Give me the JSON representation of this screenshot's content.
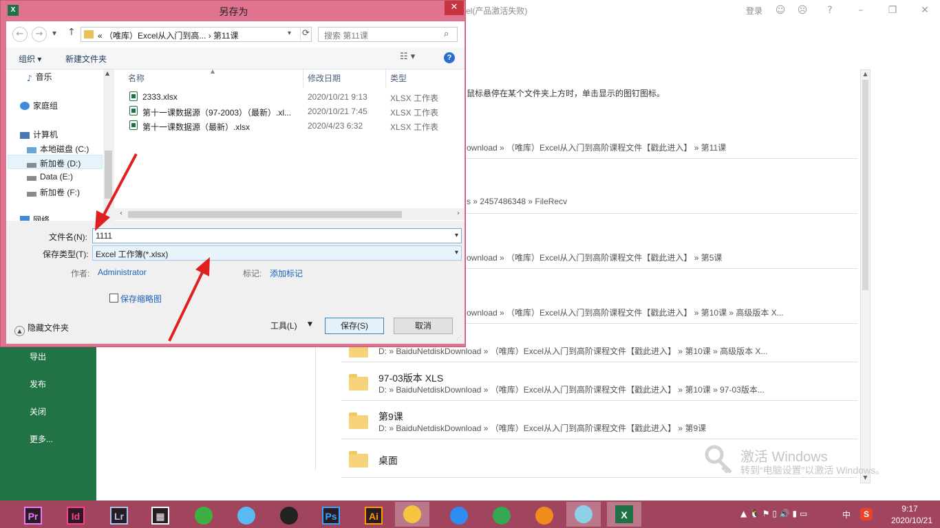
{
  "colors": {
    "dialog_frame": "#e0738f",
    "close_button": "#c7343f",
    "excel_green": "#217346",
    "taskbar": "#a0455d",
    "link": "#1c62b9",
    "annotation_arrow": "#e02020"
  },
  "background": {
    "title": "el(产品激活失败)",
    "login": "登录",
    "hint": "鼠标悬停在某个文件夹上方时，单击显示的图钉图标。",
    "left_nav": [
      "导出",
      "发布",
      "关闭",
      "更多..."
    ],
    "recent": [
      {
        "name": "",
        "path": "ownload » （唯库）Excel从入门到高阶课程文件【戳此进入】 » 第11课"
      },
      {
        "name": "",
        "path": "s » 2457486348 » FileRecv"
      },
      {
        "name": "",
        "path": "ownload » （唯库）Excel从入门到高阶课程文件【戳此进入】 » 第5课"
      },
      {
        "name": "",
        "path": "ownload » （唯库）Excel从入门到高阶课程文件【戳此进入】 » 第10课 » 高级版本 X..."
      },
      {
        "name": "",
        "path": "D: » BaiduNetdiskDownload » （唯库）Excel从入门到高阶课程文件【戳此进入】 » 第10课 » 高级版本 X..."
      },
      {
        "name": "97-03版本 XLS",
        "path": "D: » BaiduNetdiskDownload » （唯库）Excel从入门到高阶课程文件【戳此进入】 » 第10课 » 97-03版本..."
      },
      {
        "name": "第9课",
        "path": "D: » BaiduNetdiskDownload » （唯库）Excel从入门到高阶课程文件【戳此进入】 » 第9课"
      },
      {
        "name": "桌面",
        "path": ""
      }
    ],
    "activation": {
      "line1": "激活 Windows",
      "line2": "转到“电脑设置”以激活 Windows。"
    }
  },
  "dialog": {
    "title": "另存为",
    "app_icon": "X",
    "nav": {
      "back_icon": "←",
      "forward_icon": "→",
      "recent_icon": "▾",
      "up_icon": "↑",
      "address": "«  （唯库）Excel从入门到高...  ›  第11课",
      "dropdown_icon": "▾",
      "refresh_icon": "⟳",
      "search_placeholder": "搜索 第11课",
      "search_icon": "⌕"
    },
    "toolbar": {
      "organize": "组织 ▾",
      "new_folder": "新建文件夹",
      "view_icon": "☷ ▾",
      "help_icon": "?"
    },
    "tree": [
      {
        "label": "音乐",
        "icon": "music-icon"
      },
      {
        "label": "家庭组",
        "icon": "homegroup-icon"
      },
      {
        "label": "计算机",
        "icon": "computer-icon"
      },
      {
        "label": "本地磁盘 (C:)",
        "icon": "drive-icon"
      },
      {
        "label": "新加卷 (D:)",
        "icon": "drive-icon"
      },
      {
        "label": "Data (E:)",
        "icon": "drive-icon"
      },
      {
        "label": "新加卷 (F:)",
        "icon": "drive-icon"
      },
      {
        "label": "网络",
        "icon": "network-icon"
      }
    ],
    "columns": {
      "name": "名称",
      "date": "修改日期",
      "type": "类型"
    },
    "files": [
      {
        "name": "2333.xlsx",
        "date": "2020/10/21 9:13",
        "type": "XLSX 工作表"
      },
      {
        "name": "第十一课数据源（97-2003）（最新）.xl...",
        "date": "2020/10/21 7:45",
        "type": "XLSX 工作表"
      },
      {
        "name": "第十一课数据源（最新）.xlsx",
        "date": "2020/4/23 6:32",
        "type": "XLSX 工作表"
      }
    ],
    "form": {
      "filename_label": "文件名(N):",
      "filename_value": "1111",
      "type_label": "保存类型(T):",
      "type_value": "Excel 工作簿(*.xlsx)",
      "author_label": "作者:",
      "author_value": "Administrator",
      "tags_label": "标记:",
      "tags_value": "添加标记",
      "thumbnail_label": "保存缩略图",
      "thumbnail_checked": false,
      "hide_folders": "隐藏文件夹",
      "tools": "工具(L)",
      "save": "保存(S)",
      "cancel": "取消"
    }
  },
  "taskbar": {
    "apps": [
      {
        "name": "Premiere",
        "label": "Pr",
        "color": "#e77bff"
      },
      {
        "name": "InDesign",
        "label": "Id",
        "color": "#ff3f8c"
      },
      {
        "name": "Lightroom",
        "label": "Lr",
        "color": "#a8c8f0"
      },
      {
        "name": "Video",
        "label": "▦",
        "color": "#ffffff"
      },
      {
        "name": "Sketch",
        "label": "",
        "color": "#3cb043"
      },
      {
        "name": "Chat",
        "label": "",
        "color": "#5ab9f0"
      },
      {
        "name": "QQ",
        "label": "",
        "color": "#222222"
      },
      {
        "name": "Photoshop",
        "label": "Ps",
        "color": "#31a8ff"
      },
      {
        "name": "Illustrator",
        "label": "Ai",
        "color": "#ff9a00"
      },
      {
        "name": "Explorer",
        "label": "",
        "color": "#f5c542"
      },
      {
        "name": "Browser",
        "label": "",
        "color": "#2f8cf0"
      },
      {
        "name": "Chrome",
        "label": "",
        "color": "#34a853"
      },
      {
        "name": "Fox",
        "label": "",
        "color": "#f08c1e"
      },
      {
        "name": "Notes",
        "label": "",
        "color": "#8fd0e8"
      },
      {
        "name": "Excel",
        "label": "X",
        "color": "#1f7244"
      }
    ],
    "tray_icons": "▲ 🐧 ⚑ ▯ 🔊 ▮ ▭",
    "ime": "中",
    "sogou": "S",
    "time": "9:17",
    "date": "2020/10/21"
  }
}
